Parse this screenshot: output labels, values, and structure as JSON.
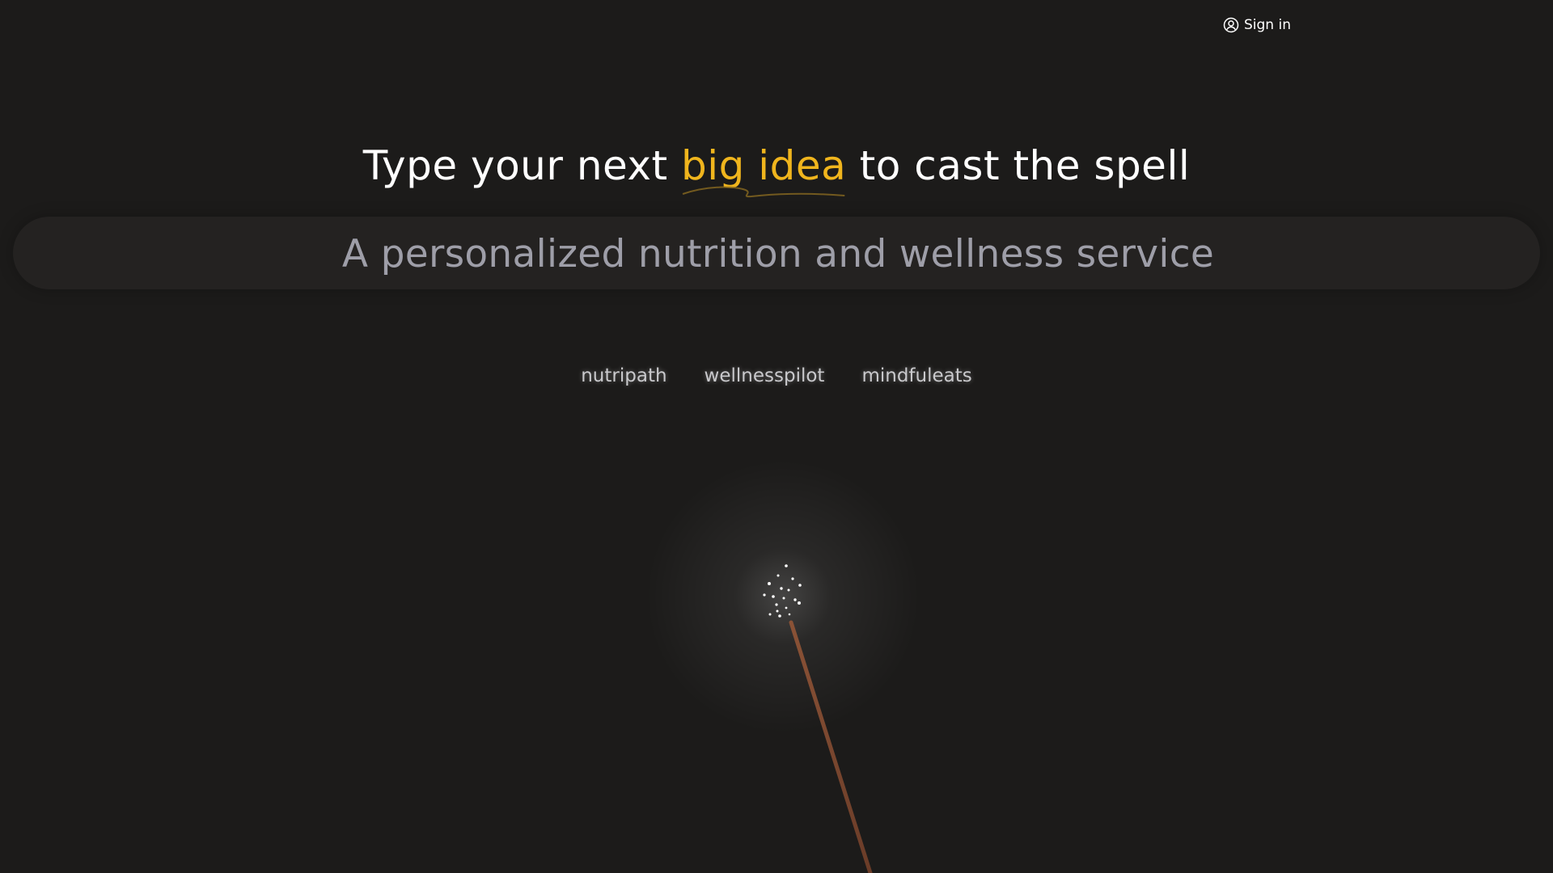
{
  "header": {
    "sign_in_label": "Sign in",
    "icon": "user-circle-icon"
  },
  "headline": {
    "before": "Type your next ",
    "highlight": "big idea",
    "after": " to cast the spell",
    "highlight_color": "#f0b51d"
  },
  "idea_input": {
    "value": "A personalized nutrition and wellness service",
    "placeholder": "A personalized nutrition and wellness service"
  },
  "suggestions": [
    {
      "label": "nutripath"
    },
    {
      "label": "wellnesspilot"
    },
    {
      "label": "mindfuleats"
    }
  ],
  "decoration": {
    "icon": "sparkler-icon"
  },
  "colors": {
    "background": "#1c1b1a",
    "input_background": "#242221",
    "input_text": "#9e9ea8",
    "suggestion_text": "#c9c9cc",
    "wand": "#7a4a30"
  }
}
